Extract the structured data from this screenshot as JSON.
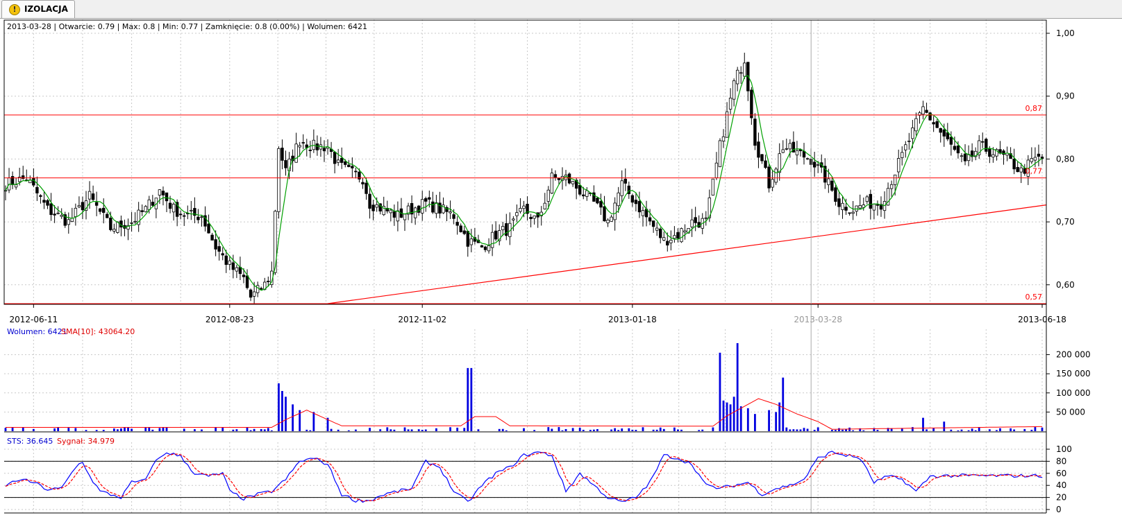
{
  "tab": {
    "label": "IZOLACJA",
    "icon": "warning-icon"
  },
  "price_info": "2013-03-28 | Otwarcie: 0.79 | Max: 0.8 | Min: 0.77 | Zamknięcie: 0.8 (0.00%)  | Wolumen: 6421",
  "volume_info": {
    "volume_label": "Wolumen: 6421",
    "sma_label": "SMA[10]: 43064.20"
  },
  "sts_info": {
    "sts_label": "STS: 36.645",
    "signal_label": "Sygnał: 34.979"
  },
  "cursor_date": "2013-03-28",
  "colors": {
    "bull": "#ffffff",
    "bear": "#000000",
    "sma": "#00a000",
    "level": "#ff0000",
    "volume": "#0000e0",
    "volume_sma": "#ff0000",
    "sts": "#0000ff",
    "signal": "#ff0000",
    "grid": "#c8c8c8"
  },
  "chart_data": [
    {
      "type": "candlestick",
      "x_dates": [
        "2012-06-11",
        "2012-08-23",
        "2012-11-02",
        "2013-01-18",
        "2013-03-28",
        "2013-06-18"
      ],
      "ylim": [
        0.57,
        1.0
      ],
      "y_ticks": [
        "1,00",
        "0,90",
        "0,80",
        "0,70",
        "0,60"
      ],
      "ohlc_anchor_closes": [
        [
          0,
          0.76
        ],
        [
          6,
          0.77
        ],
        [
          12,
          0.72
        ],
        [
          18,
          0.7
        ],
        [
          24,
          0.74
        ],
        [
          30,
          0.69
        ],
        [
          36,
          0.7
        ],
        [
          40,
          0.72
        ],
        [
          44,
          0.75
        ],
        [
          48,
          0.72
        ],
        [
          52,
          0.71
        ],
        [
          56,
          0.71
        ],
        [
          60,
          0.66
        ],
        [
          64,
          0.63
        ],
        [
          68,
          0.61
        ],
        [
          70,
          0.58
        ],
        [
          74,
          0.6
        ],
        [
          76,
          0.62
        ],
        [
          78,
          0.82
        ],
        [
          80,
          0.78
        ],
        [
          84,
          0.83
        ],
        [
          88,
          0.82
        ],
        [
          92,
          0.82
        ],
        [
          95,
          0.79
        ],
        [
          98,
          0.78
        ],
        [
          102,
          0.77
        ],
        [
          104,
          0.73
        ],
        [
          108,
          0.72
        ],
        [
          112,
          0.71
        ],
        [
          116,
          0.72
        ],
        [
          120,
          0.73
        ],
        [
          124,
          0.72
        ],
        [
          128,
          0.71
        ],
        [
          132,
          0.67
        ],
        [
          136,
          0.66
        ],
        [
          140,
          0.68
        ],
        [
          144,
          0.69
        ],
        [
          148,
          0.72
        ],
        [
          152,
          0.7
        ],
        [
          156,
          0.77
        ],
        [
          160,
          0.77
        ],
        [
          164,
          0.75
        ],
        [
          168,
          0.73
        ],
        [
          172,
          0.7
        ],
        [
          176,
          0.76
        ],
        [
          180,
          0.73
        ],
        [
          184,
          0.7
        ],
        [
          188,
          0.67
        ],
        [
          192,
          0.68
        ],
        [
          196,
          0.7
        ],
        [
          200,
          0.7
        ],
        [
          204,
          0.82
        ],
        [
          208,
          0.92
        ],
        [
          211,
          0.96
        ],
        [
          214,
          0.83
        ],
        [
          218,
          0.76
        ],
        [
          222,
          0.82
        ],
        [
          226,
          0.81
        ],
        [
          230,
          0.8
        ],
        [
          234,
          0.77
        ],
        [
          238,
          0.73
        ],
        [
          242,
          0.72
        ],
        [
          246,
          0.73
        ],
        [
          250,
          0.73
        ],
        [
          254,
          0.78
        ],
        [
          258,
          0.83
        ],
        [
          262,
          0.88
        ],
        [
          266,
          0.85
        ],
        [
          270,
          0.82
        ],
        [
          274,
          0.79
        ],
        [
          278,
          0.82
        ],
        [
          282,
          0.81
        ],
        [
          286,
          0.8
        ],
        [
          290,
          0.78
        ],
        [
          294,
          0.8
        ],
        [
          296,
          0.8
        ]
      ],
      "levels": [
        {
          "value": 0.87,
          "label": "0,87"
        },
        {
          "value": 0.77,
          "label": "0,77"
        },
        {
          "value": 0.57,
          "label": "0,57"
        }
      ],
      "trendline": {
        "from": [
          "2012-09-28",
          0.57
        ],
        "to": [
          "2013-06-18",
          0.727
        ]
      },
      "sma_period": 5
    },
    {
      "type": "bar",
      "title": "Wolumen",
      "ylim": [
        0,
        230000
      ],
      "y_ticks": [
        "200 000",
        "150 000",
        "100 000",
        "50 000"
      ],
      "spikes": [
        [
          78,
          125000
        ],
        [
          79,
          105000
        ],
        [
          80,
          90000
        ],
        [
          82,
          70000
        ],
        [
          84,
          55000
        ],
        [
          88,
          50000
        ],
        [
          92,
          35000
        ],
        [
          132,
          165000
        ],
        [
          133,
          165000
        ],
        [
          204,
          205000
        ],
        [
          205,
          80000
        ],
        [
          206,
          75000
        ],
        [
          207,
          70000
        ],
        [
          208,
          90000
        ],
        [
          209,
          230000
        ],
        [
          210,
          65000
        ],
        [
          212,
          60000
        ],
        [
          214,
          45000
        ],
        [
          218,
          55000
        ],
        [
          220,
          50000
        ],
        [
          221,
          75000
        ],
        [
          222,
          140000
        ],
        [
          232,
          10000
        ],
        [
          262,
          35000
        ],
        [
          268,
          25000
        ]
      ],
      "volume_sma_series": [
        [
          0,
          10000
        ],
        [
          76,
          10000
        ],
        [
          80,
          30000
        ],
        [
          86,
          55000
        ],
        [
          92,
          30000
        ],
        [
          96,
          14000
        ],
        [
          130,
          14000
        ],
        [
          134,
          38000
        ],
        [
          140,
          38000
        ],
        [
          144,
          14000
        ],
        [
          202,
          13000
        ],
        [
          206,
          40000
        ],
        [
          212,
          70000
        ],
        [
          215,
          85000
        ],
        [
          220,
          70000
        ],
        [
          226,
          45000
        ],
        [
          232,
          25000
        ],
        [
          236,
          5000
        ],
        [
          296,
          12000
        ]
      ]
    },
    {
      "type": "line",
      "title": "STS",
      "ylim": [
        0,
        100
      ],
      "y_ticks": [
        "100",
        "80",
        "60",
        "40",
        "20",
        "0"
      ],
      "bands": [
        80,
        20
      ],
      "sts_series": [
        [
          0,
          40
        ],
        [
          4,
          50
        ],
        [
          8,
          45
        ],
        [
          12,
          33
        ],
        [
          16,
          35
        ],
        [
          20,
          70
        ],
        [
          22,
          80
        ],
        [
          24,
          55
        ],
        [
          27,
          30
        ],
        [
          30,
          25
        ],
        [
          33,
          20
        ],
        [
          36,
          45
        ],
        [
          40,
          48
        ],
        [
          42,
          75
        ],
        [
          46,
          95
        ],
        [
          50,
          88
        ],
        [
          54,
          60
        ],
        [
          58,
          55
        ],
        [
          62,
          60
        ],
        [
          64,
          30
        ],
        [
          68,
          18
        ],
        [
          72,
          25
        ],
        [
          76,
          30
        ],
        [
          80,
          50
        ],
        [
          84,
          80
        ],
        [
          88,
          85
        ],
        [
          92,
          75
        ],
        [
          96,
          25
        ],
        [
          100,
          15
        ],
        [
          104,
          15
        ],
        [
          108,
          25
        ],
        [
          112,
          30
        ],
        [
          116,
          35
        ],
        [
          120,
          80
        ],
        [
          124,
          70
        ],
        [
          128,
          30
        ],
        [
          132,
          12
        ],
        [
          136,
          40
        ],
        [
          140,
          60
        ],
        [
          144,
          70
        ],
        [
          148,
          90
        ],
        [
          152,
          95
        ],
        [
          156,
          90
        ],
        [
          160,
          30
        ],
        [
          164,
          60
        ],
        [
          168,
          40
        ],
        [
          172,
          20
        ],
        [
          176,
          12
        ],
        [
          180,
          20
        ],
        [
          184,
          45
        ],
        [
          188,
          90
        ],
        [
          192,
          85
        ],
        [
          196,
          75
        ],
        [
          200,
          40
        ],
        [
          204,
          35
        ],
        [
          208,
          40
        ],
        [
          212,
          45
        ],
        [
          216,
          25
        ],
        [
          220,
          35
        ],
        [
          224,
          40
        ],
        [
          228,
          50
        ],
        [
          232,
          85
        ],
        [
          236,
          95
        ],
        [
          240,
          90
        ],
        [
          244,
          85
        ],
        [
          248,
          45
        ],
        [
          252,
          55
        ],
        [
          256,
          50
        ],
        [
          260,
          30
        ],
        [
          264,
          55
        ],
        [
          268,
          56
        ]
      ],
      "signal_period": 4
    }
  ]
}
